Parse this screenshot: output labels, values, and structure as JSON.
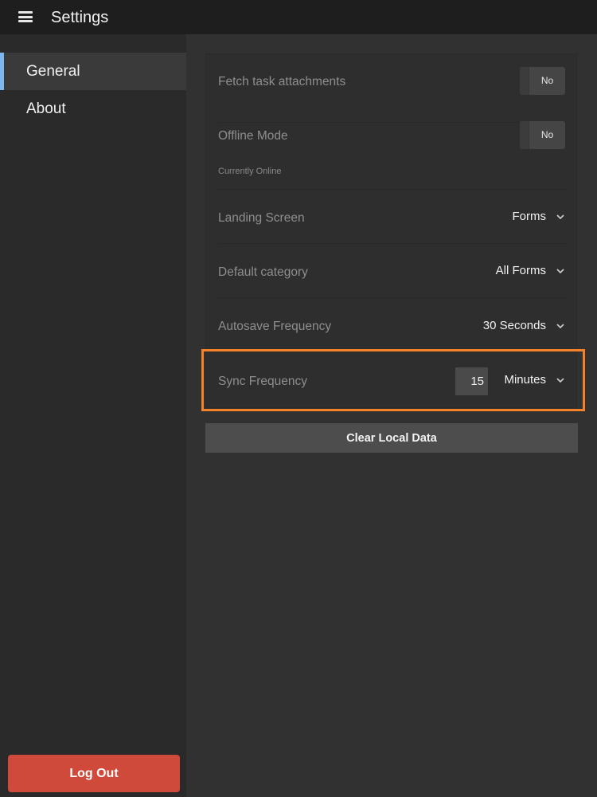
{
  "header": {
    "title": "Settings",
    "menu_icon": "hamburger-menu-icon"
  },
  "sidebar": {
    "items": [
      {
        "label": "General",
        "active": true
      },
      {
        "label": "About",
        "active": false
      }
    ],
    "logout_label": "Log Out"
  },
  "settings": {
    "fetch_attachments": {
      "label": "Fetch task attachments",
      "value": "No"
    },
    "offline_mode": {
      "label": "Offline Mode",
      "value": "No",
      "status": "Currently Online"
    },
    "landing_screen": {
      "label": "Landing Screen",
      "value": "Forms"
    },
    "default_category": {
      "label": "Default category",
      "value": "All Forms"
    },
    "autosave_frequency": {
      "label": "Autosave Frequency",
      "value": "30 Seconds"
    },
    "sync_frequency": {
      "label": "Sync Frequency",
      "amount": "15",
      "unit": "Minutes"
    }
  },
  "actions": {
    "clear_local_data": "Clear Local Data"
  },
  "colors": {
    "accent_nav": "#7db7ee",
    "logout": "#d04a3b",
    "highlight": "#f5822a"
  }
}
